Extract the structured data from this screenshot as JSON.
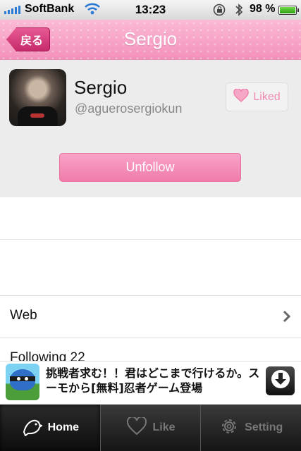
{
  "status_bar": {
    "carrier": "SoftBank",
    "time": "13:23",
    "battery": "98 %",
    "battery_level": 0.98
  },
  "nav": {
    "back_label": "戻る",
    "title": "Sergio"
  },
  "profile": {
    "name": "Sergio",
    "handle": "@aguerosergiokun",
    "liked_label": "Liked",
    "unfollow_label": "Unfollow"
  },
  "list": {
    "rows": [
      {
        "label": ""
      },
      {
        "label": ""
      },
      {
        "label": "Web"
      },
      {
        "label": "Following 22"
      }
    ]
  },
  "ad": {
    "text": "挑戦者求む！！君はどこまで行けるか。スーモから[無料]忍者ゲーム登場"
  },
  "tabs": [
    {
      "label": "Home",
      "icon": "bird-icon",
      "active": true
    },
    {
      "label": "Like",
      "icon": "heart-icon",
      "active": false
    },
    {
      "label": "Setting",
      "icon": "gear-icon",
      "active": false
    }
  ],
  "colors": {
    "accent_pink": "#f391bc",
    "back_button": "#d63b7a",
    "liked_text": "#f08bb3"
  }
}
